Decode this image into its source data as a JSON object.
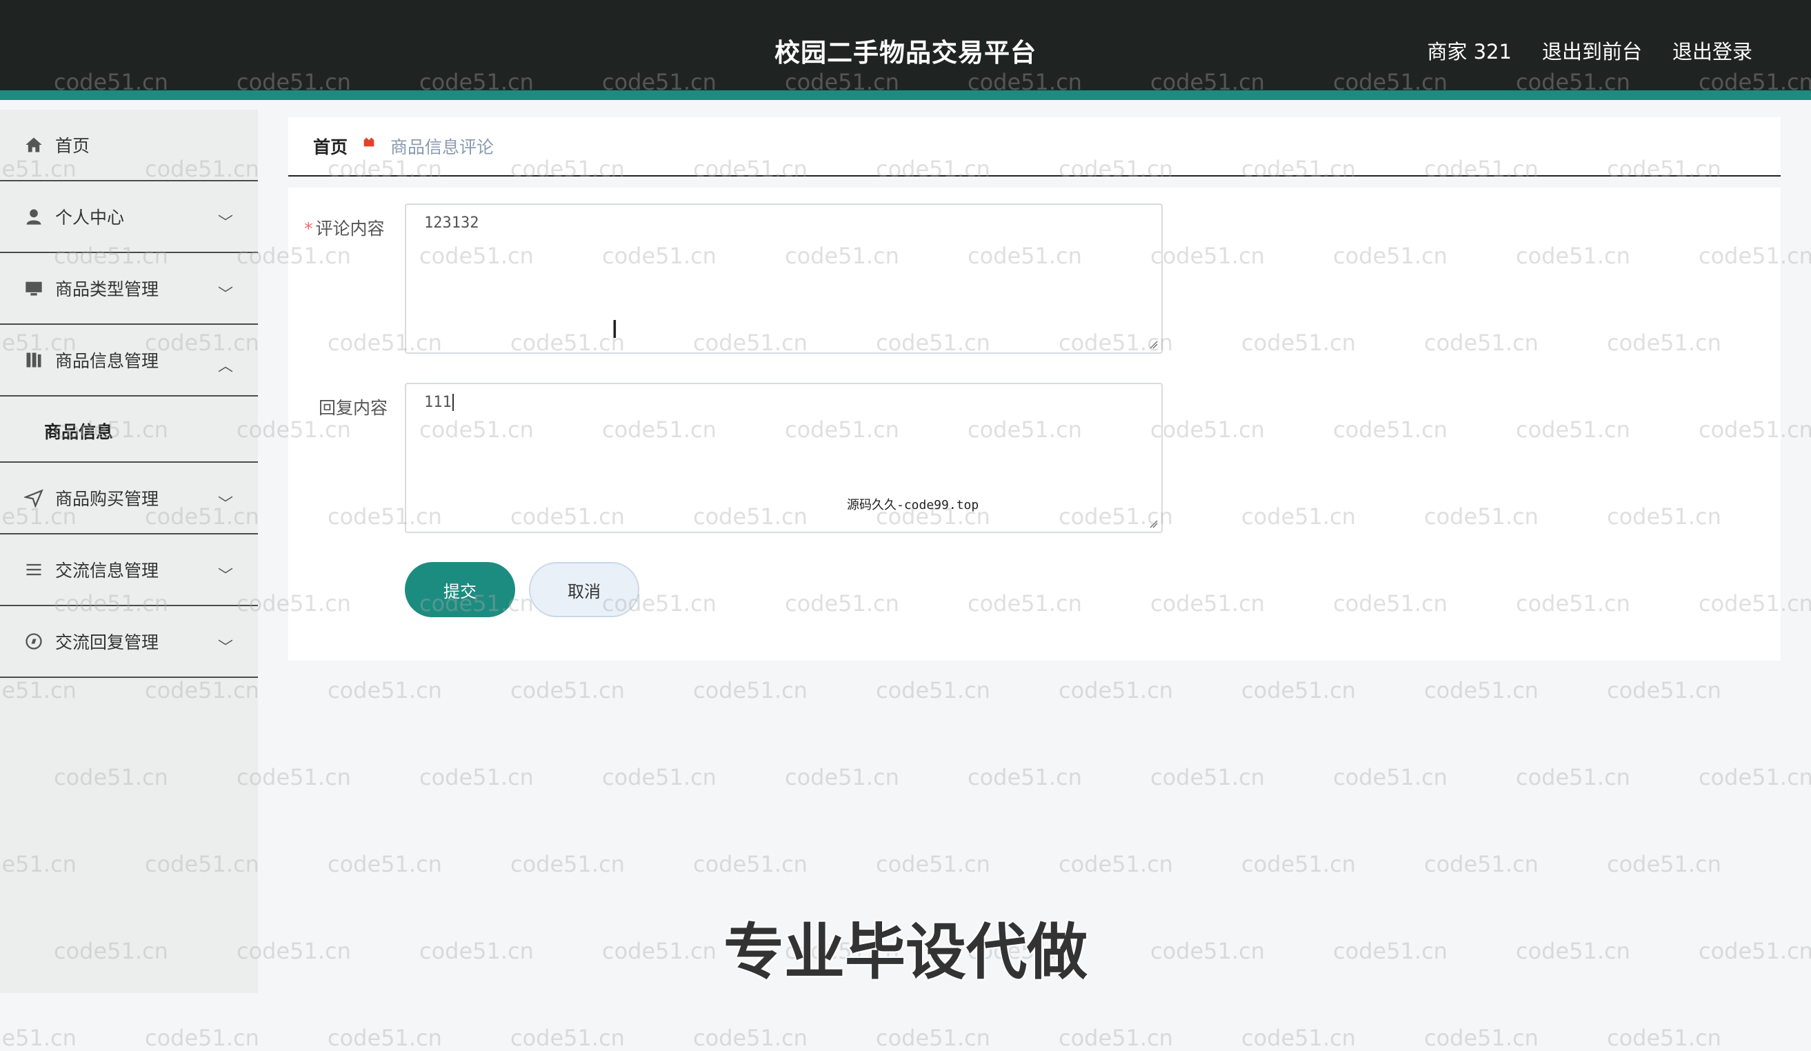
{
  "header": {
    "title": "校园二手物品交易平台",
    "user": "商家 321",
    "back_to_front": "退出到前台",
    "logout": "退出登录"
  },
  "sidebar": {
    "items": [
      {
        "label": "首页",
        "icon": "home-icon"
      },
      {
        "label": "个人中心",
        "icon": "user-icon"
      },
      {
        "label": "商品类型管理",
        "icon": "monitor-icon"
      },
      {
        "label": "商品信息管理",
        "icon": "book-icon"
      },
      {
        "label": "商品购买管理",
        "icon": "send-icon"
      },
      {
        "label": "交流信息管理",
        "icon": "list-icon"
      },
      {
        "label": "交流回复管理",
        "icon": "compass-icon"
      }
    ],
    "sub_item": "商品信息"
  },
  "breadcrumb": {
    "home": "首页",
    "current": "商品信息评论"
  },
  "form": {
    "comment_label": "评论内容",
    "comment_value": "123132",
    "reply_label": "回复内容",
    "reply_value": "111",
    "submit": "提交",
    "cancel": "取消"
  },
  "overlay": {
    "watermark": "code51.cn",
    "center_mark": "源码久久-code99.top",
    "caption": "专业毕设代做"
  },
  "colors": {
    "header_bg": "#1f2322",
    "accent": "#1d8c80",
    "required": "#f56c6c"
  }
}
